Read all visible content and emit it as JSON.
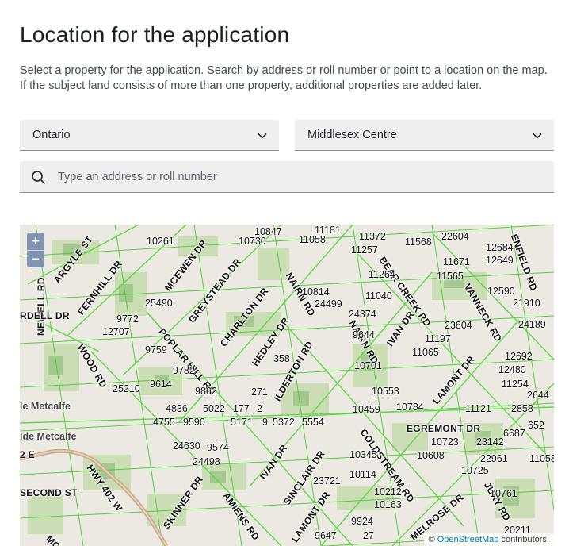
{
  "page": {
    "title": "Location for the application",
    "description": "Select a property for the application. Search by address or roll number or point to a location on the map. If the subject land consists of more than one property, additional properties are added later."
  },
  "selects": {
    "province": "Ontario",
    "municipality": "Middlesex Centre"
  },
  "search": {
    "placeholder": "Type an address or roll number"
  },
  "map": {
    "zoom_in": "+",
    "zoom_out": "−",
    "attribution_prefix": "©",
    "attribution_link": "OpenStreetMap",
    "attribution_suffix": "contributors.",
    "roads": [
      "ARGYLE ST",
      "FERNHILL DR",
      "MCEWEN DR",
      "GREYSTEAD DR",
      "NAIRN RD",
      "BEAR CREEK RD",
      "VANNECK RD",
      "ENFIELD RD",
      "CHARLTON DR",
      "POPLAR HILL RD",
      "HEDLEY DR",
      "ILDERTON RD",
      "NAIRN RD",
      "IVAN DR",
      "LAMONT DR",
      "WOOD RD",
      "NEWELL RD",
      "EGREMONT DR",
      "COLDSTREAM RD",
      "JURY RD",
      "IVAN DR",
      "SINCLAIR DR",
      "MELROSE DR",
      "HWY 402 W",
      "SKINNER DR",
      "AMIENS RD",
      "LAMONT DR",
      "SECOND ST",
      "MCEVOY",
      "RDELL DR",
      "2 E"
    ],
    "places": [
      "le Metcalfe",
      "lde Metcalfe"
    ],
    "numbers": [
      "10847",
      "11181",
      "10261",
      "10730",
      "11058",
      "11372",
      "11568",
      "22604",
      "12684",
      "11257",
      "12649",
      "11671",
      "11264",
      "11565",
      "10814",
      "12590",
      "25490",
      "24499",
      "11040",
      "21910",
      "9772",
      "24374",
      "23804",
      "12707",
      "9644",
      "24189",
      "11197",
      "9759",
      "358",
      "11065",
      "12692",
      "9782",
      "10701",
      "12480",
      "9614",
      "25210",
      "9862",
      "271",
      "10553",
      "11254",
      "2644",
      "4836",
      "5022",
      "177",
      "2",
      "10459",
      "10784",
      "11121",
      "2858",
      "4755",
      "9590",
      "5171",
      "9",
      "5372",
      "5554",
      "6687",
      "652",
      "10723",
      "23142",
      "24630",
      "9574",
      "10608",
      "10345",
      "22961",
      "11058",
      "24498",
      "10725",
      "10114",
      "23721",
      "10212",
      "10761",
      "10163",
      "9924",
      "9647",
      "27",
      "20211"
    ]
  }
}
